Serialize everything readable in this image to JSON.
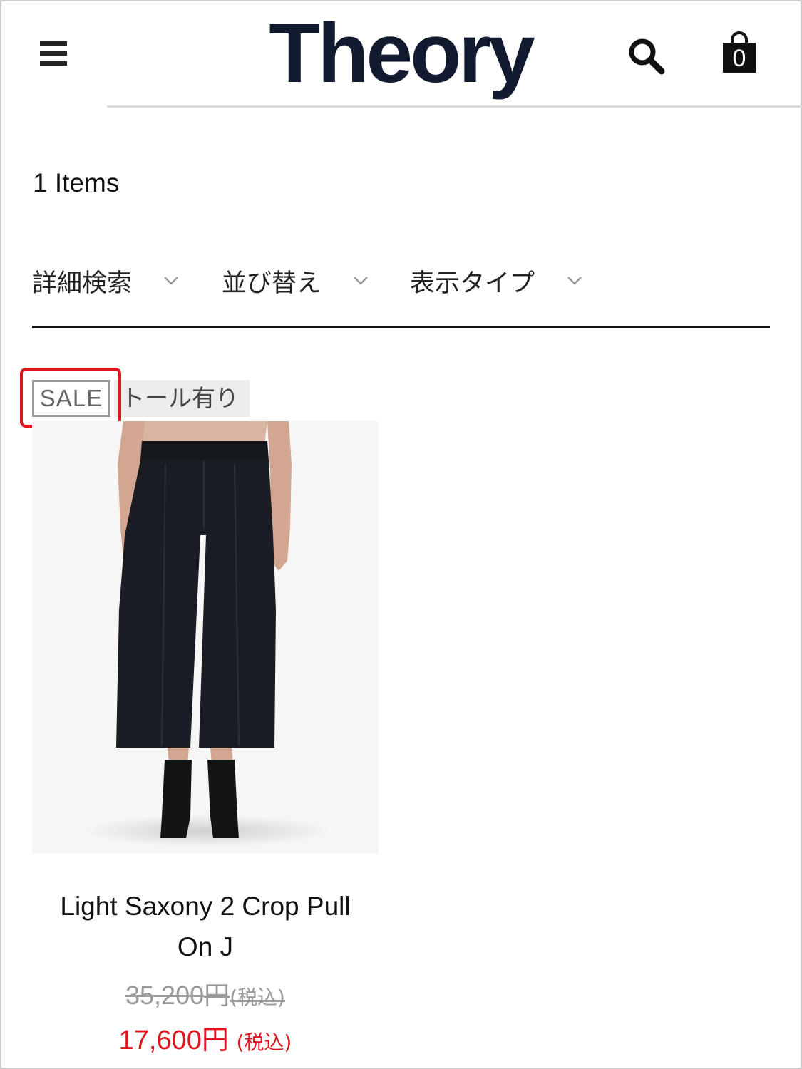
{
  "header": {
    "logo": "Theory",
    "cart_count": "0"
  },
  "listing": {
    "item_count": "1 Items"
  },
  "filters": [
    {
      "label": "詳細検索"
    },
    {
      "label": "並び替え"
    },
    {
      "label": "表示タイプ"
    }
  ],
  "product": {
    "tags": {
      "sale": "SALE",
      "tall": "トール有り"
    },
    "name_line1": "Light Saxony 2 Crop Pull",
    "name_line2": "On J",
    "original_price": {
      "amount": "35,200",
      "currency": "円",
      "tax": "(税込)"
    },
    "sale_price": {
      "amount": "17,600",
      "currency": "円",
      "tax": "(税込)"
    }
  },
  "colors": {
    "sale_price": "#e0161f",
    "highlight_border": "#e0161f",
    "logo": "#111a2e"
  }
}
